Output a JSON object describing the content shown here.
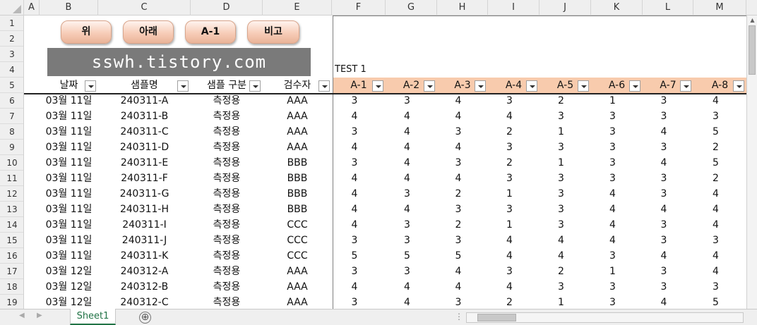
{
  "columns": [
    "A",
    "B",
    "C",
    "D",
    "E",
    "F",
    "G",
    "H",
    "I",
    "J",
    "K",
    "L",
    "M"
  ],
  "rows": [
    "1",
    "2",
    "3",
    "4",
    "5",
    "6",
    "7",
    "8",
    "9",
    "10",
    "11",
    "12",
    "13",
    "14",
    "15",
    "16",
    "17",
    "18",
    "19"
  ],
  "buttons": {
    "up": "위",
    "down": "아래",
    "a1": "A-1",
    "compare": "비고"
  },
  "banner": "sswh.tistory.com",
  "test_label": "TEST 1",
  "headers": {
    "date": "날짜",
    "sample": "샘플명",
    "category": "샘플 구분",
    "inspector": "검수자",
    "a": [
      "A-1",
      "A-2",
      "A-3",
      "A-4",
      "A-5",
      "A-6",
      "A-7",
      "A-8"
    ]
  },
  "data": [
    {
      "date": "03월 11일",
      "sample": "240311-A",
      "category": "측정용",
      "inspector": "AAA",
      "v": [
        "3",
        "3",
        "4",
        "3",
        "2",
        "1",
        "3",
        "4"
      ]
    },
    {
      "date": "03월 11일",
      "sample": "240311-B",
      "category": "측정용",
      "inspector": "AAA",
      "v": [
        "4",
        "4",
        "4",
        "4",
        "3",
        "3",
        "3",
        "3"
      ]
    },
    {
      "date": "03월 11일",
      "sample": "240311-C",
      "category": "측정용",
      "inspector": "AAA",
      "v": [
        "3",
        "4",
        "3",
        "2",
        "1",
        "3",
        "4",
        "5"
      ]
    },
    {
      "date": "03월 11일",
      "sample": "240311-D",
      "category": "측정용",
      "inspector": "AAA",
      "v": [
        "4",
        "4",
        "4",
        "3",
        "3",
        "3",
        "3",
        "2"
      ]
    },
    {
      "date": "03월 11일",
      "sample": "240311-E",
      "category": "측정용",
      "inspector": "BBB",
      "v": [
        "3",
        "4",
        "3",
        "2",
        "1",
        "3",
        "4",
        "5"
      ]
    },
    {
      "date": "03월 11일",
      "sample": "240311-F",
      "category": "측정용",
      "inspector": "BBB",
      "v": [
        "4",
        "4",
        "4",
        "3",
        "3",
        "3",
        "3",
        "2"
      ]
    },
    {
      "date": "03월 11일",
      "sample": "240311-G",
      "category": "측정용",
      "inspector": "BBB",
      "v": [
        "4",
        "3",
        "2",
        "1",
        "3",
        "4",
        "3",
        "4"
      ]
    },
    {
      "date": "03월 11일",
      "sample": "240311-H",
      "category": "측정용",
      "inspector": "BBB",
      "v": [
        "4",
        "4",
        "3",
        "3",
        "3",
        "4",
        "4",
        "4"
      ]
    },
    {
      "date": "03월 11일",
      "sample": "240311-I",
      "category": "측정용",
      "inspector": "CCC",
      "v": [
        "4",
        "3",
        "2",
        "1",
        "3",
        "4",
        "3",
        "4"
      ]
    },
    {
      "date": "03월 11일",
      "sample": "240311-J",
      "category": "측정용",
      "inspector": "CCC",
      "v": [
        "3",
        "3",
        "3",
        "4",
        "4",
        "4",
        "3",
        "3"
      ]
    },
    {
      "date": "03월 11일",
      "sample": "240311-K",
      "category": "측정용",
      "inspector": "CCC",
      "v": [
        "5",
        "5",
        "5",
        "4",
        "4",
        "3",
        "4",
        "4"
      ]
    },
    {
      "date": "03월 12일",
      "sample": "240312-A",
      "category": "측정용",
      "inspector": "AAA",
      "v": [
        "3",
        "3",
        "4",
        "3",
        "2",
        "1",
        "3",
        "4"
      ]
    },
    {
      "date": "03월 12일",
      "sample": "240312-B",
      "category": "측정용",
      "inspector": "AAA",
      "v": [
        "4",
        "4",
        "4",
        "4",
        "3",
        "3",
        "3",
        "3"
      ]
    },
    {
      "date": "03월 12일",
      "sample": "240312-C",
      "category": "측정용",
      "inspector": "AAA",
      "v": [
        "3",
        "4",
        "3",
        "2",
        "1",
        "3",
        "4",
        "5"
      ]
    }
  ],
  "sheet_tab": "Sheet1",
  "add_sheet": "⊕"
}
